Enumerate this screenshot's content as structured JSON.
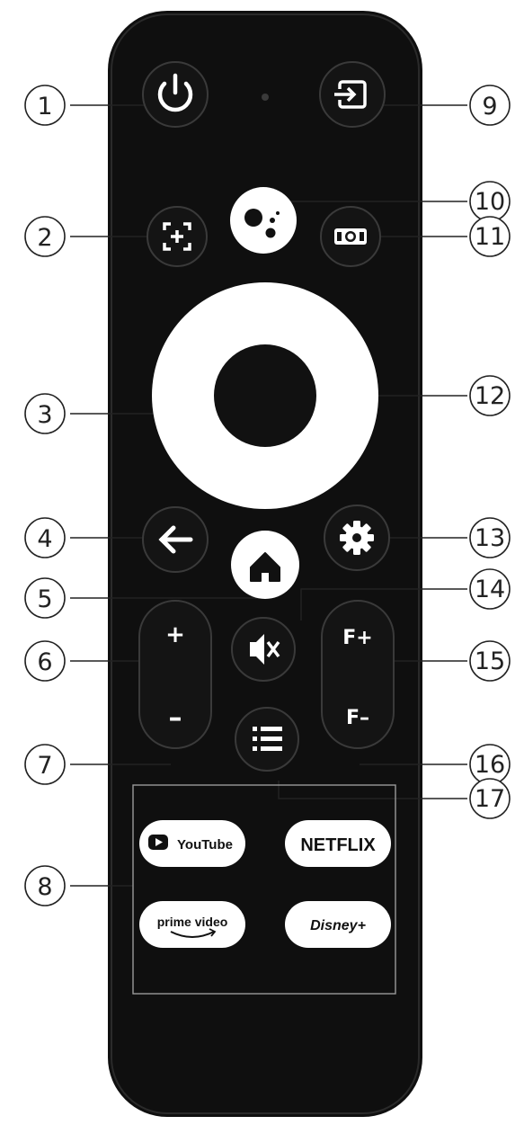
{
  "callouts": [
    "1",
    "2",
    "3",
    "4",
    "5",
    "6",
    "7",
    "8",
    "9",
    "10",
    "11",
    "12",
    "13",
    "14",
    "15",
    "16",
    "17"
  ],
  "buttons": {
    "volume_up": "+",
    "volume_down": "–",
    "focus_up": "F+",
    "focus_down": "F–"
  },
  "apps": {
    "youtube": "YouTube",
    "netflix": "NETFLIX",
    "prime": "prime video",
    "disney": "Disney+"
  },
  "colors": {
    "remote_body": "#0f0f0f",
    "button": "#141414",
    "dpad_ring": "#ffffff",
    "line": "#222222"
  }
}
